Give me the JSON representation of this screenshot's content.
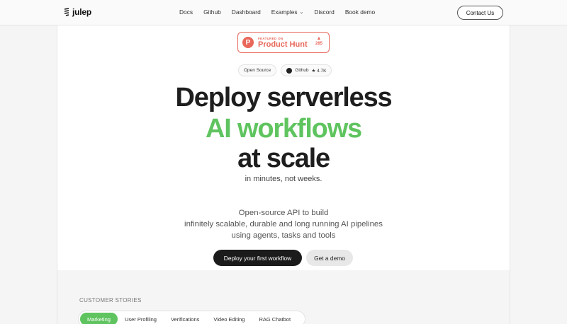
{
  "header": {
    "logo_text": "julep",
    "nav": [
      {
        "label": "Docs"
      },
      {
        "label": "Github"
      },
      {
        "label": "Dashboard"
      },
      {
        "label": "Examples"
      },
      {
        "label": "Discord"
      },
      {
        "label": "Book demo"
      }
    ],
    "contact_label": "Contact Us"
  },
  "product_hunt": {
    "small_label": "FEATURED ON",
    "name": "Product Hunt",
    "votes": "285",
    "color": "#e8675a"
  },
  "pills": {
    "open_source": "Open Source",
    "github": "Github",
    "stars": "★ 4.7K"
  },
  "hero": {
    "line1": "Deploy serverless",
    "line2": "AI workflows",
    "line3": "at scale",
    "subtitle": "in minutes, not weeks.",
    "desc_line1": "Open-source API to build",
    "desc_line2": "infinitely scalable, durable and long running AI pipelines",
    "desc_line3": "using agents, tasks and tools",
    "accent": "#5fc45f"
  },
  "cta": {
    "primary": "Deploy your first workflow",
    "secondary": "Get a demo"
  },
  "stories": {
    "title": "CUSTOMER STORIES",
    "tabs": [
      {
        "label": "Marketing",
        "active": true
      },
      {
        "label": "User Profiling",
        "active": false
      },
      {
        "label": "Verifications",
        "active": false
      },
      {
        "label": "Video Editing",
        "active": false
      },
      {
        "label": "RAG Chatbot",
        "active": false
      }
    ]
  }
}
